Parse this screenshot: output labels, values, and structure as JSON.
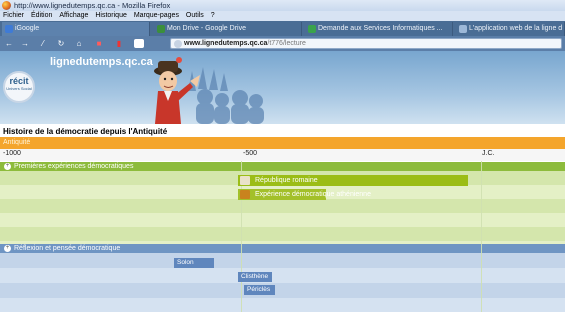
{
  "window": {
    "title": "http://www.lignedutemps.qc.ca - Mozilla Firefox"
  },
  "menu": [
    "Fichier",
    "Édition",
    "Affichage",
    "Historique",
    "Marque-pages",
    "Outils",
    "?"
  ],
  "tabs": [
    "iGoogle",
    "Mon Drive - Google Drive",
    "Demande aux Services Informatiques ...",
    "L'application web de la ligne d"
  ],
  "url": {
    "host": "www.lignedutemps.qc.ca",
    "path": "/t776/lecture"
  },
  "site": {
    "name": "lignedutemps.qc.ca",
    "logo_main": "récit",
    "logo_sub": "Univers Social"
  },
  "timeline": {
    "title": "Histoire de la démocratie depuis l'Antiquité",
    "era": "Antiquité",
    "ticks": [
      "-1000",
      "-500",
      "J.C."
    ],
    "sections": [
      {
        "label": "Premières expériences démocratiques",
        "events": [
          "République romaine",
          "Expérience démocratique athénienne"
        ]
      },
      {
        "label": "Réflexion et pensée démocratique",
        "people": [
          "Solon",
          "Clisthène",
          "Périclès"
        ]
      }
    ]
  },
  "colors": {
    "era": "#f4a52c",
    "section1": "#8dbb3c",
    "section2": "#6f95c3",
    "event_bar": "#9bbd16"
  }
}
